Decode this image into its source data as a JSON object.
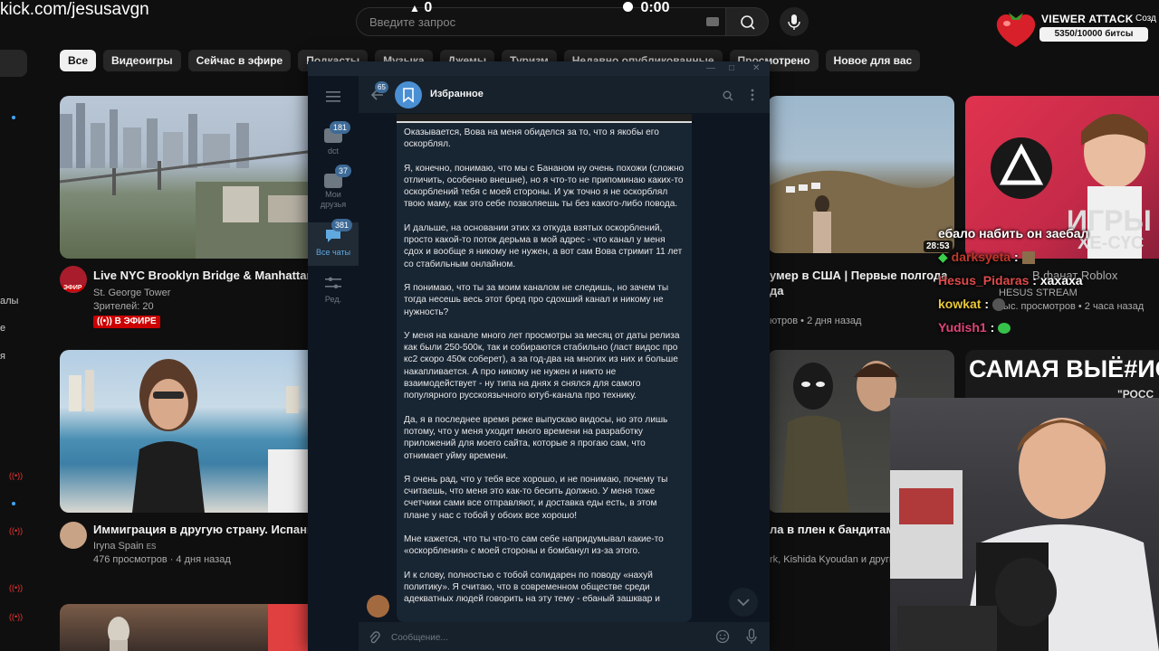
{
  "overlay": {
    "kick_url": "kick.com/jesusavgn",
    "bell_count": "0",
    "timer": "0:00",
    "viewer_attack": {
      "title": "VIEWER ATTACK",
      "progress_text": "5350/10000 битсы",
      "progress_fraction": 0.535
    },
    "partial_label": "Созд",
    "chat": [
      {
        "user": "",
        "text": "ебало набить он заебал",
        "color": "#ffffff"
      },
      {
        "user": "darksyeta",
        "text": ":",
        "color": "#c0392b"
      },
      {
        "user": "Hesus_Pidaras",
        "text": "хахаха",
        "color": "#e04a4a"
      },
      {
        "user": "kowkat",
        "text": ":",
        "color": "#e8c83a"
      },
      {
        "user": "Yudish1",
        "text": ":",
        "color": "#e0447a"
      }
    ]
  },
  "youtube": {
    "search_placeholder": "Введите запрос",
    "chips": [
      "Все",
      "Видеоигры",
      "Сейчас в эфире",
      "Подкасты",
      "Музыка",
      "Джемы",
      "Туризм",
      "Недавно опубликованные",
      "Просмотрено",
      "Новое для вас"
    ],
    "videos": [
      {
        "title": "Live NYC Brooklyn Bridge & Manhattan cam",
        "channel": "St. George Tower",
        "stats": "Зрителей: 20",
        "badge": "В ЭФИРЕ",
        "avatar_label": "ЭФИР"
      },
      {
        "title": "Иммиграция в другую страну. Испания.",
        "channel": "Iryna Spain",
        "channel_suffix": "ES",
        "stats": "476 просмотров · 4 дня назад"
      },
      {
        "title": "умер в США | Первые полгода",
        "title2": "да",
        "stats": "ютров • 2 дня назад",
        "duration": "28:53"
      },
      {
        "title": "ла в плен к бандитам и",
        "stats": "rk, Kishida Kyoudan и други"
      },
      {
        "thumb_text": "ИГРЫ",
        "thumb_text2": "ХЕ-СҮС",
        "title": "В фанат Roblox",
        "channel": "HESUS STREAM",
        "stats": "тыс. просмотров • 2 часа назад"
      },
      {
        "thumb_text": "САМАЯ ВЫЁ#ИСТА",
        "thumb_text2": "\"РОСС"
      }
    ]
  },
  "telegram": {
    "chat_title": "Избранное",
    "back_badge": "65",
    "folders": [
      {
        "label": "dct",
        "badge": "181"
      },
      {
        "label": "Мои друзья",
        "badge": "37"
      },
      {
        "label": "Все чаты",
        "badge": "381"
      },
      {
        "label": "Ред."
      }
    ],
    "input_placeholder": "Сообщение...",
    "message_paragraphs": [
      "Оказывается, Вова на меня обиделся за то, что я якобы его оскорблял.",
      "Я, конечно, понимаю, что мы с Бананом ну очень похожи (сложно отличить, особенно внешне), но я что-то не припоминаю каких-то оскорблений тебя с моей стороны. И уж точно я не оскорблял твою маму, как это себе позволяешь ты без какого-либо повода.",
      "И дальше, на основании этих хз откуда взятых оскорблений, просто какой-то поток дерьма в мой адрес - что канал у меня сдох и вообще я никому не нужен, а вот сам Вова стримит 11 лет со стабильным онлайном.",
      "Я понимаю, что ты за моим каналом не следишь, но зачем ты тогда несешь весь этот бред про сдохший канал и никому не нужность?",
      "У меня на канале много лет просмотры за месяц от даты релиза как были 250-500к, так и собираются стабильно (ласт видос про кс2 скоро 450к соберет), а за год-два на многих из них и больше накапливается. А про никому не нужен и никто не взаимодействует - ну типа на днях я снялся для самого популярного русскоязычного ютуб-канала про технику.",
      "Да, я в последнее время реже выпускаю видосы, но это лишь потому, что у меня уходит много времени на разработку приложений для моего сайта, которые я прогаю сам, что отнимает уйму времени.",
      "Я очень рад, что у тебя все хорошо, и не понимаю, почему ты считаешь, что меня это как-то бесить должно. У меня тоже счетчики сами все отправляют, и доставка еды есть, в этом плане у нас с тобой у обоих все хорошо!",
      "Мне кажется, что ты что-то сам себе напридумывал какие-то «оскорбления» с моей стороны и бомбанул из-за этого.",
      "И к слову, полностью с тобой солидарен по поводу «нахуй политику». Я считаю, что в современном обществе среди адекватных людей говорить на эту тему - ебаный зашквар и"
    ]
  }
}
